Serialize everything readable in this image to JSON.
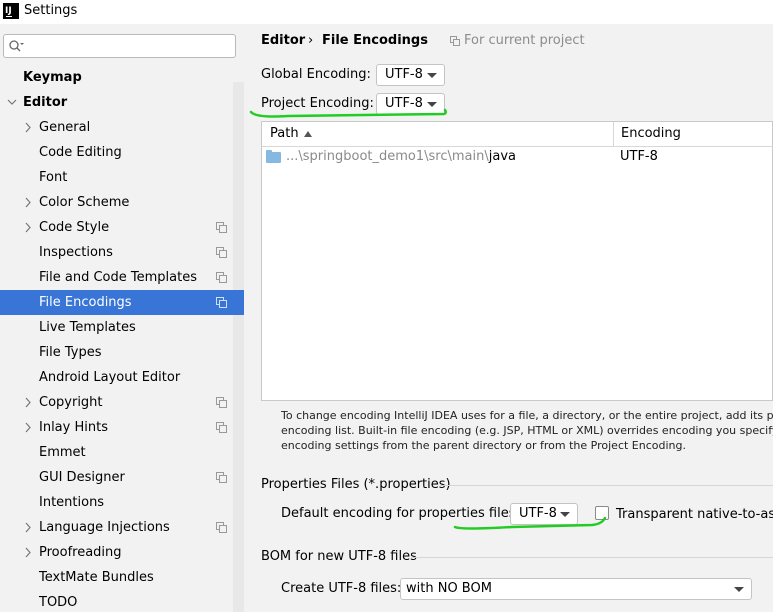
{
  "window": {
    "title": "Settings",
    "logo_text": "IJ"
  },
  "sidebar": {
    "search_placeholder": "",
    "items": [
      {
        "label": "Keymap"
      },
      {
        "label": "Editor"
      },
      {
        "label": "General"
      },
      {
        "label": "Code Editing"
      },
      {
        "label": "Font"
      },
      {
        "label": "Color Scheme"
      },
      {
        "label": "Code Style"
      },
      {
        "label": "Inspections"
      },
      {
        "label": "File and Code Templates"
      },
      {
        "label": "File Encodings"
      },
      {
        "label": "Live Templates"
      },
      {
        "label": "File Types"
      },
      {
        "label": "Android Layout Editor"
      },
      {
        "label": "Copyright"
      },
      {
        "label": "Inlay Hints"
      },
      {
        "label": "Emmet"
      },
      {
        "label": "GUI Designer"
      },
      {
        "label": "Intentions"
      },
      {
        "label": "Language Injections"
      },
      {
        "label": "Proofreading"
      },
      {
        "label": "TextMate Bundles"
      },
      {
        "label": "TODO"
      }
    ]
  },
  "header": {
    "breadcrumb_parent": "Editor",
    "separator": "›",
    "breadcrumb_current": "File Encodings",
    "scope_text": "For current project"
  },
  "encoding": {
    "global_label": "Global Encoding:",
    "global_value": "UTF-8",
    "project_label": "Project Encoding:",
    "project_value": "UTF-8"
  },
  "table": {
    "columns": [
      "Path",
      "Encoding"
    ],
    "rows": [
      {
        "path_prefix": "...\\springboot_demo1\\src\\main\\",
        "path_leaf": "java",
        "encoding": "UTF-8"
      }
    ]
  },
  "help_text": {
    "line1": "To change encoding IntelliJ IDEA uses for a file, a directory, or the entire project, add its path if",
    "line2": "encoding list. Built-in file encoding (e.g. JSP, HTML or XML) overrides encoding you specify he",
    "line3": "encoding settings from the parent directory or from the Project Encoding."
  },
  "properties": {
    "section_title": "Properties Files (*.properties)",
    "default_label": "Default encoding for properties files:",
    "default_value": "UTF-8",
    "transparent_label": "Transparent native-to-ascii",
    "transparent_checked": false
  },
  "bom": {
    "section_title": "BOM for new UTF-8 files",
    "create_label": "Create UTF-8 files:",
    "create_value": "with NO BOM"
  },
  "colors": {
    "selection": "#3875d6",
    "annotation_green": "#22cc22"
  }
}
